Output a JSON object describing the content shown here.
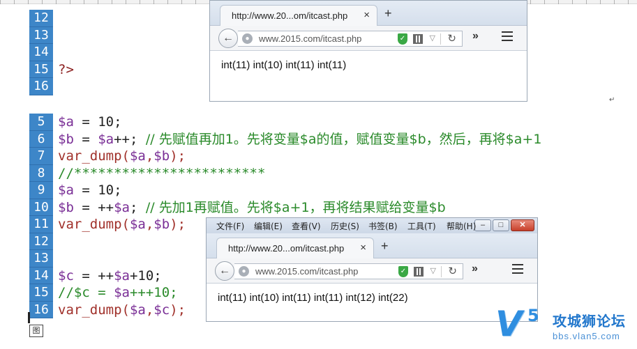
{
  "editor": {
    "block1": [
      {
        "ln": "12",
        "tokens": []
      },
      {
        "ln": "13",
        "tokens": []
      },
      {
        "ln": "14",
        "tokens": []
      },
      {
        "ln": "15",
        "tokens": [
          {
            "t": "?>",
            "k": "php"
          }
        ]
      },
      {
        "ln": "16",
        "tokens": []
      }
    ],
    "block2": [
      {
        "ln": "5",
        "tokens": [
          {
            "t": "$a",
            "k": "var"
          },
          {
            "t": " = 10;",
            "k": "op"
          }
        ]
      },
      {
        "ln": "6",
        "tokens": [
          {
            "t": "$b",
            "k": "var"
          },
          {
            "t": " = ",
            "k": "op"
          },
          {
            "t": "$a",
            "k": "var"
          },
          {
            "t": "++; ",
            "k": "op"
          },
          {
            "t": "// 先赋值再加1。先将变量$a的值，赋值变量$b，然后，再将$a+1",
            "k": "comment"
          }
        ]
      },
      {
        "ln": "7",
        "tokens": [
          {
            "t": "var_dump(",
            "k": "fn"
          },
          {
            "t": "$a",
            "k": "var"
          },
          {
            "t": ",",
            "k": "fn"
          },
          {
            "t": "$b",
            "k": "var"
          },
          {
            "t": ");",
            "k": "fn"
          }
        ]
      },
      {
        "ln": "8",
        "tokens": [
          {
            "t": "//************************",
            "k": "comment"
          }
        ]
      },
      {
        "ln": "9",
        "tokens": [
          {
            "t": "$a",
            "k": "var"
          },
          {
            "t": " = 10;",
            "k": "op"
          }
        ]
      },
      {
        "ln": "10",
        "tokens": [
          {
            "t": "$b",
            "k": "var"
          },
          {
            "t": " = ++",
            "k": "op"
          },
          {
            "t": "$a",
            "k": "var"
          },
          {
            "t": "; ",
            "k": "op"
          },
          {
            "t": "// 先加1再赋值。先将$a+1，再将结果赋给变量$b",
            "k": "comment"
          }
        ]
      },
      {
        "ln": "11",
        "tokens": [
          {
            "t": "var_dump(",
            "k": "fn"
          },
          {
            "t": "$a",
            "k": "var"
          },
          {
            "t": ",",
            "k": "fn"
          },
          {
            "t": "$b",
            "k": "var"
          },
          {
            "t": ");",
            "k": "fn"
          }
        ]
      },
      {
        "ln": "12",
        "tokens": []
      },
      {
        "ln": "13",
        "tokens": []
      },
      {
        "ln": "14",
        "tokens": [
          {
            "t": "$c",
            "k": "var"
          },
          {
            "t": " = ++",
            "k": "op"
          },
          {
            "t": "$a",
            "k": "var"
          },
          {
            "t": "+10;",
            "k": "op"
          }
        ]
      },
      {
        "ln": "15",
        "tokens": [
          {
            "t": "//$c = ",
            "k": "comment"
          },
          {
            "t": "$a",
            "k": "var"
          },
          {
            "t": "+++10;",
            "k": "comment"
          }
        ]
      },
      {
        "ln": "16",
        "tokens": [
          {
            "t": "var_dump(",
            "k": "fn"
          },
          {
            "t": "$a",
            "k": "var"
          },
          {
            "t": ",",
            "k": "fn"
          },
          {
            "t": "$c",
            "k": "var"
          },
          {
            "t": ");",
            "k": "fn"
          }
        ]
      }
    ],
    "return_mark": "↵",
    "cursor_box_glyph": "图"
  },
  "browser1": {
    "tab_title": "http://www.20...om/itcast.php",
    "tab_close": "×",
    "new_tab": "+",
    "url": "www.2015.com/itcast.php",
    "output": "int(11) int(10) int(11) int(11)"
  },
  "browser2": {
    "menu": [
      "文件(F)",
      "编辑(E)",
      "查看(V)",
      "历史(S)",
      "书签(B)",
      "工具(T)",
      "帮助(H)"
    ],
    "win_min": "–",
    "win_max": "□",
    "win_close": "✕",
    "tab_title": "http://www.20...om/itcast.php",
    "tab_close": "×",
    "new_tab": "+",
    "url": "www.2015.com/itcast.php",
    "output": "int(11) int(10) int(11) int(11) int(12) int(22)"
  },
  "icons": {
    "back": "←",
    "globe": "●",
    "reload": "↻",
    "dropdown": "▽",
    "overflow": "»",
    "shield": "✓"
  },
  "watermark": {
    "logo": "V",
    "logo_num": "5",
    "title": "攻城狮论坛",
    "url": "bbs.vlan5.com"
  }
}
